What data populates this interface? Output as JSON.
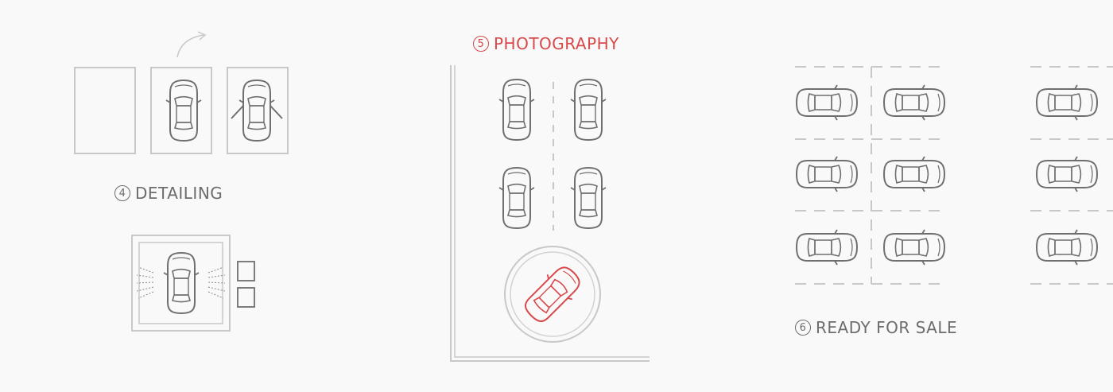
{
  "colors": {
    "background": "#f9f9f9",
    "line": "#c8c8c8",
    "car": "#6f6f6f",
    "label": "#6c6c6c",
    "accent": "#d9494b"
  },
  "steps": {
    "detailing": {
      "number": "4",
      "title": "DETAILING"
    },
    "photography": {
      "number": "5",
      "title": "PHOTOGRAPHY"
    },
    "ready_for_sale": {
      "number": "6",
      "title": "READY FOR SALE"
    }
  }
}
